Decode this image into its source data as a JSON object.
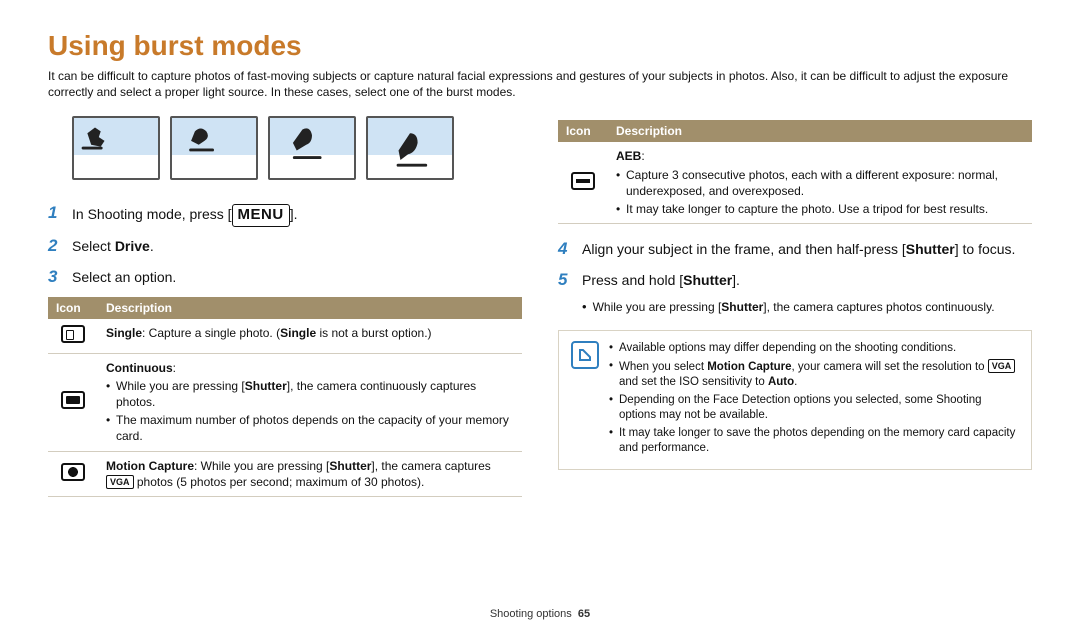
{
  "title": "Using burst modes",
  "intro": "It can be difficult to capture photos of fast-moving subjects or capture natural facial expressions and gestures of your subjects in photos. Also, it can be difficult to adjust the exposure correctly and select a proper light source. In these cases, select one of the burst modes.",
  "table_headers": {
    "icon": "Icon",
    "desc": "Description"
  },
  "left": {
    "step1_a": "In Shooting mode, press [",
    "step1_btn": "MENU",
    "step1_b": "].",
    "step2_a": "Select ",
    "step2_b": "Drive",
    "step2_c": ".",
    "step3": "Select an option.",
    "rows": {
      "single": {
        "label": "Single",
        "text": ": Capture a single photo. (",
        "label2": "Single",
        "text2": " is not a burst option.)"
      },
      "cont": {
        "label": "Continuous",
        "colon": ":",
        "b1_a": "While you are pressing [",
        "b1_b": "Shutter",
        "b1_c": "], the camera continuously captures photos.",
        "b2": "The maximum number of photos depends on the capacity of your memory card."
      },
      "motion": {
        "label": "Motion Capture",
        "a1": ": While you are pressing [",
        "a2": "Shutter",
        "a3": "], the camera captures ",
        "vga": "VGA",
        "a4": " photos (5 photos per second; maximum of 30 photos)."
      }
    }
  },
  "right": {
    "rows": {
      "aeb": {
        "label": "AEB",
        "colon": ":",
        "b1": "Capture 3 consecutive photos, each with a different exposure: normal, underexposed, and overexposed.",
        "b2": "It may take longer to capture the photo. Use a tripod for best results."
      }
    },
    "step4_a": "Align your subject in the frame, and then half-press [",
    "step4_b": "Shutter",
    "step4_c": "] to focus.",
    "step5_a": "Press and hold [",
    "step5_b": "Shutter",
    "step5_c": "].",
    "step5_sub_a": "While you are pressing [",
    "step5_sub_b": "Shutter",
    "step5_sub_c": "], the camera captures photos continuously.",
    "notes": {
      "n1": "Available options may differ depending on the shooting conditions.",
      "n2_a": "When you select ",
      "n2_b": "Motion Capture",
      "n2_c": ", your camera will set the resolution to ",
      "n2_vga": "VGA",
      "n2_d": " and set the ISO sensitivity to ",
      "n2_e": "Auto",
      "n2_f": ".",
      "n3": "Depending on the Face Detection options you selected, some Shooting options may not be available.",
      "n4": "It may take longer to save the photos depending on the memory card capacity and performance."
    }
  },
  "footer": {
    "section": "Shooting options",
    "page": "65"
  }
}
